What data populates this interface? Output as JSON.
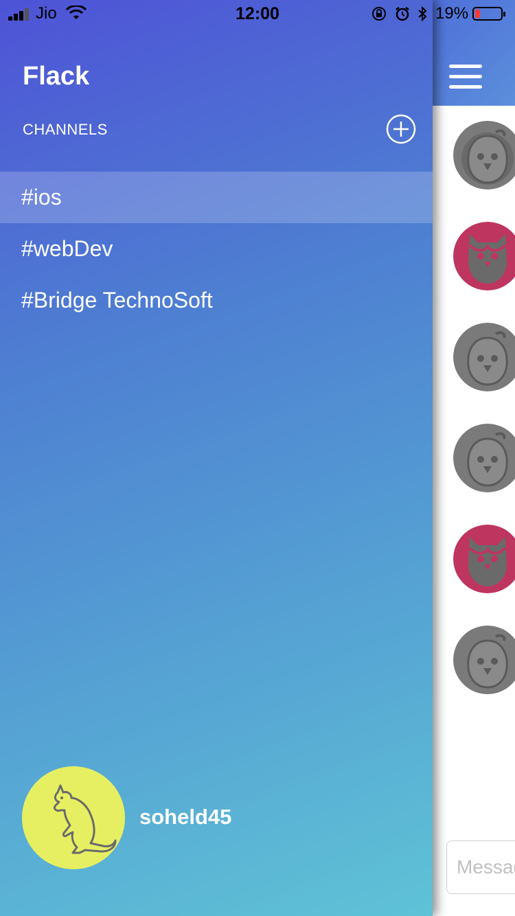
{
  "status_bar": {
    "carrier": "Jio",
    "time": "12:00",
    "battery_percent": "19%",
    "battery_level": 0.19,
    "battery_color": "#ff3b30"
  },
  "drawer": {
    "app_title": "Flack",
    "channels_label": "CHANNELS",
    "add_channel_icon": "plus-circle-icon",
    "channels": [
      {
        "label": "#ios",
        "selected": true
      },
      {
        "label": "#webDev",
        "selected": false
      },
      {
        "label": "#Bridge TechnoSoft",
        "selected": false
      }
    ],
    "user": {
      "username": "soheld45",
      "avatar_icon": "kangaroo-icon",
      "avatar_color": "#e6ef62"
    }
  },
  "main": {
    "menu_icon": "hamburger-menu-icon",
    "message_avatars": [
      {
        "icon": "penguin-icon",
        "color": "#7a7a7a"
      },
      {
        "icon": "owl-icon",
        "color": "#be3560"
      },
      {
        "icon": "penguin-icon",
        "color": "#7a7a7a"
      },
      {
        "icon": "penguin-icon",
        "color": "#7a7a7a"
      },
      {
        "icon": "owl-icon",
        "color": "#be3560"
      },
      {
        "icon": "penguin-icon",
        "color": "#7a7a7a"
      }
    ],
    "message_input_placeholder": "Message"
  },
  "colors": {
    "gradient_start": "#4e53d6",
    "gradient_end": "#5fc2d6"
  }
}
